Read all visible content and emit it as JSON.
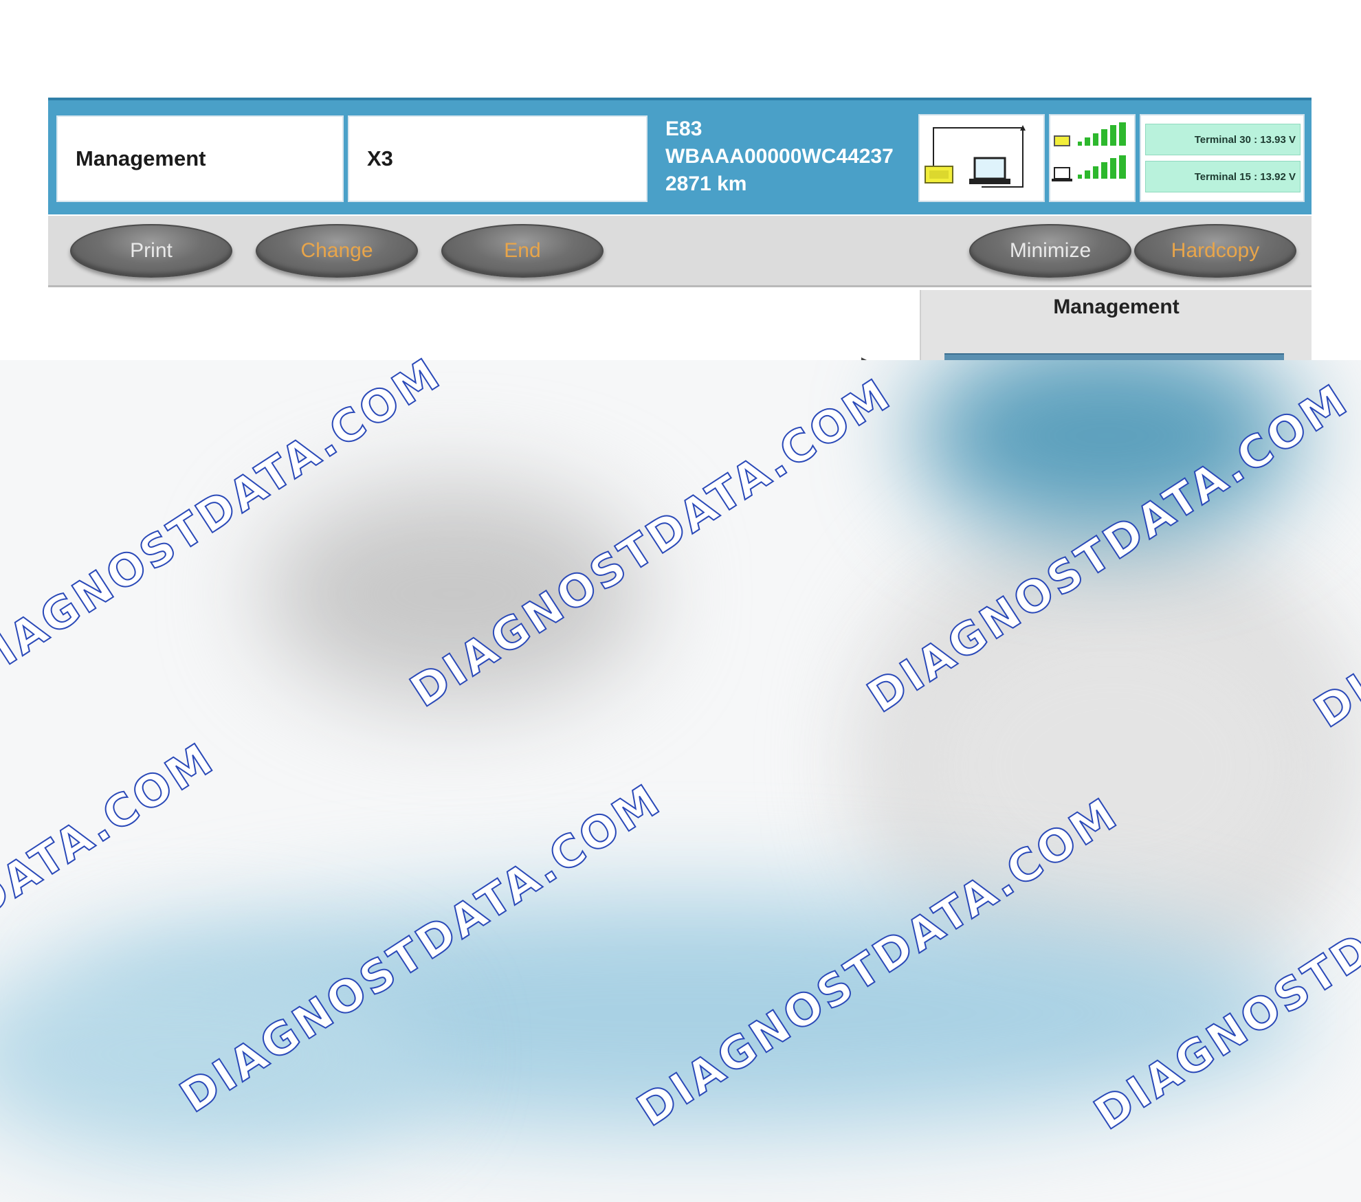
{
  "header": {
    "function_field": "Management",
    "model_field": "X3",
    "vehicle": {
      "series": "E83",
      "vin": "WBAAA00000WC44237",
      "mileage": "2871 km"
    },
    "terminals": [
      "Terminal 30 : 13.93 V",
      "Terminal 15 : 13.92 V"
    ]
  },
  "toolbar": {
    "print": "Print",
    "change": "Change",
    "end": "End",
    "minimize": "Minimize",
    "hardcopy": "Hardcopy"
  },
  "side_panel": {
    "title": "Management"
  },
  "watermark": {
    "text": "DIAGNOSTDATA.COM"
  },
  "colors": {
    "header_blue": "#4aa0c8",
    "toolbar_gray": "#dcdcdc",
    "button_orange_text": "#e8a54a",
    "terminal_green": "#b9f2dc",
    "watermark_outline": "#2a49b8"
  },
  "icons": [
    "connection-diagram-icon",
    "vci-box-icon",
    "laptop-icon",
    "signal-bars-icon"
  ]
}
